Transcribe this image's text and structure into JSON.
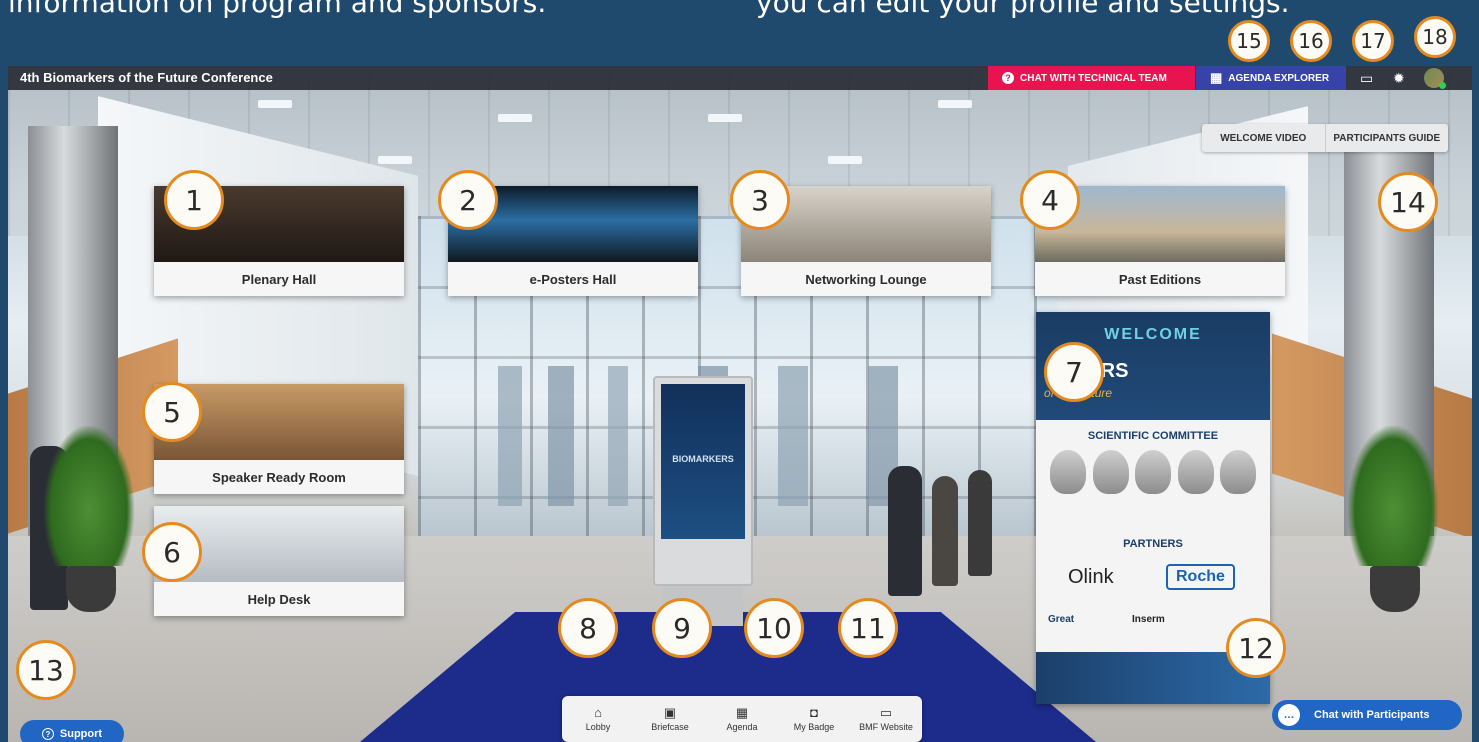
{
  "caption": {
    "left": "information on program and sponsors.",
    "right": "you can edit your profile and settings."
  },
  "header": {
    "title": "4th Biomarkers of the Future Conference",
    "chat_tech": "CHAT WITH TECHNICAL TEAM",
    "agenda_explorer": "AGENDA EXPLORER",
    "help_icon": "?",
    "agenda_icon": "▦",
    "card_icon": "▭",
    "settings_icon": "✹"
  },
  "guide": {
    "welcome_video": "WELCOME VIDEO",
    "participants_guide": "PARTICIPANTS GUIDE"
  },
  "rooms": [
    {
      "label": "Plenary Hall"
    },
    {
      "label": "e-Posters Hall"
    },
    {
      "label": "Networking Lounge"
    },
    {
      "label": "Past Editions"
    },
    {
      "label": "Speaker Ready Room"
    },
    {
      "label": "Help Desk"
    }
  ],
  "welcome_banner": {
    "title": "WELCOME",
    "brand": "ARKERS",
    "tagline": "of the Future",
    "committee": "SCIENTIFIC COMMITTEE",
    "partners": "PARTNERS",
    "partner1": "Olink",
    "partner2": "Roche",
    "partner3": "Great",
    "partner4": "Inserm"
  },
  "kiosk": {
    "text": "BIOMARKERS"
  },
  "bottom_nav": [
    {
      "icon": "⌂",
      "label": "Lobby"
    },
    {
      "icon": "▣",
      "label": "Briefcase"
    },
    {
      "icon": "▦",
      "label": "Agenda"
    },
    {
      "icon": "◘",
      "label": "My Badge"
    },
    {
      "icon": "▭",
      "label": "BMF Website"
    }
  ],
  "support": {
    "icon": "?",
    "label": "Support"
  },
  "chat_participants": {
    "icon": "…",
    "label": "Chat with Participants"
  },
  "markers": [
    "1",
    "2",
    "3",
    "4",
    "5",
    "6",
    "7",
    "8",
    "9",
    "10",
    "11",
    "12",
    "13",
    "14",
    "15",
    "16",
    "17",
    "18"
  ],
  "colors": {
    "caption_bg": "#1f4a6e",
    "chat_tech": "#e8134f",
    "agenda": "#3743a8",
    "support": "#2166c4",
    "marker_border": "#e58a1f",
    "carpet": "#1d2b8a"
  }
}
